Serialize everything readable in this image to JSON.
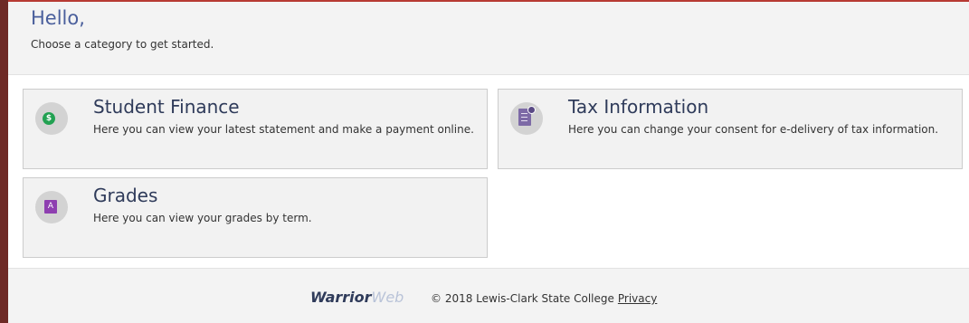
{
  "header": {
    "greeting": "Hello,",
    "subtitle": "Choose a category to get started."
  },
  "cards": [
    {
      "title": "Student Finance",
      "description": "Here you can view your latest statement and make a payment online.",
      "icon": "dollar-icon",
      "icon_glyph": "$",
      "icon_color": "#22a152"
    },
    {
      "title": "Tax Information",
      "description": "Here you can change your consent for e-delivery of tax information.",
      "icon": "tax-document-icon",
      "icon_color": "#7d6aa6"
    },
    {
      "title": "Grades",
      "description": "Here you can view your grades by term.",
      "icon": "grade-icon",
      "icon_glyph": "A",
      "icon_color": "#8e3fb0"
    }
  ],
  "footer": {
    "brand_part1": "Warrior",
    "brand_part2": "Web",
    "copyright": "© 2018 Lewis-Clark State College",
    "privacy_link": "Privacy"
  },
  "colors": {
    "accent_bar": "#6e2a26",
    "top_line": "#b73a33",
    "greeting": "#4a5f9c"
  }
}
